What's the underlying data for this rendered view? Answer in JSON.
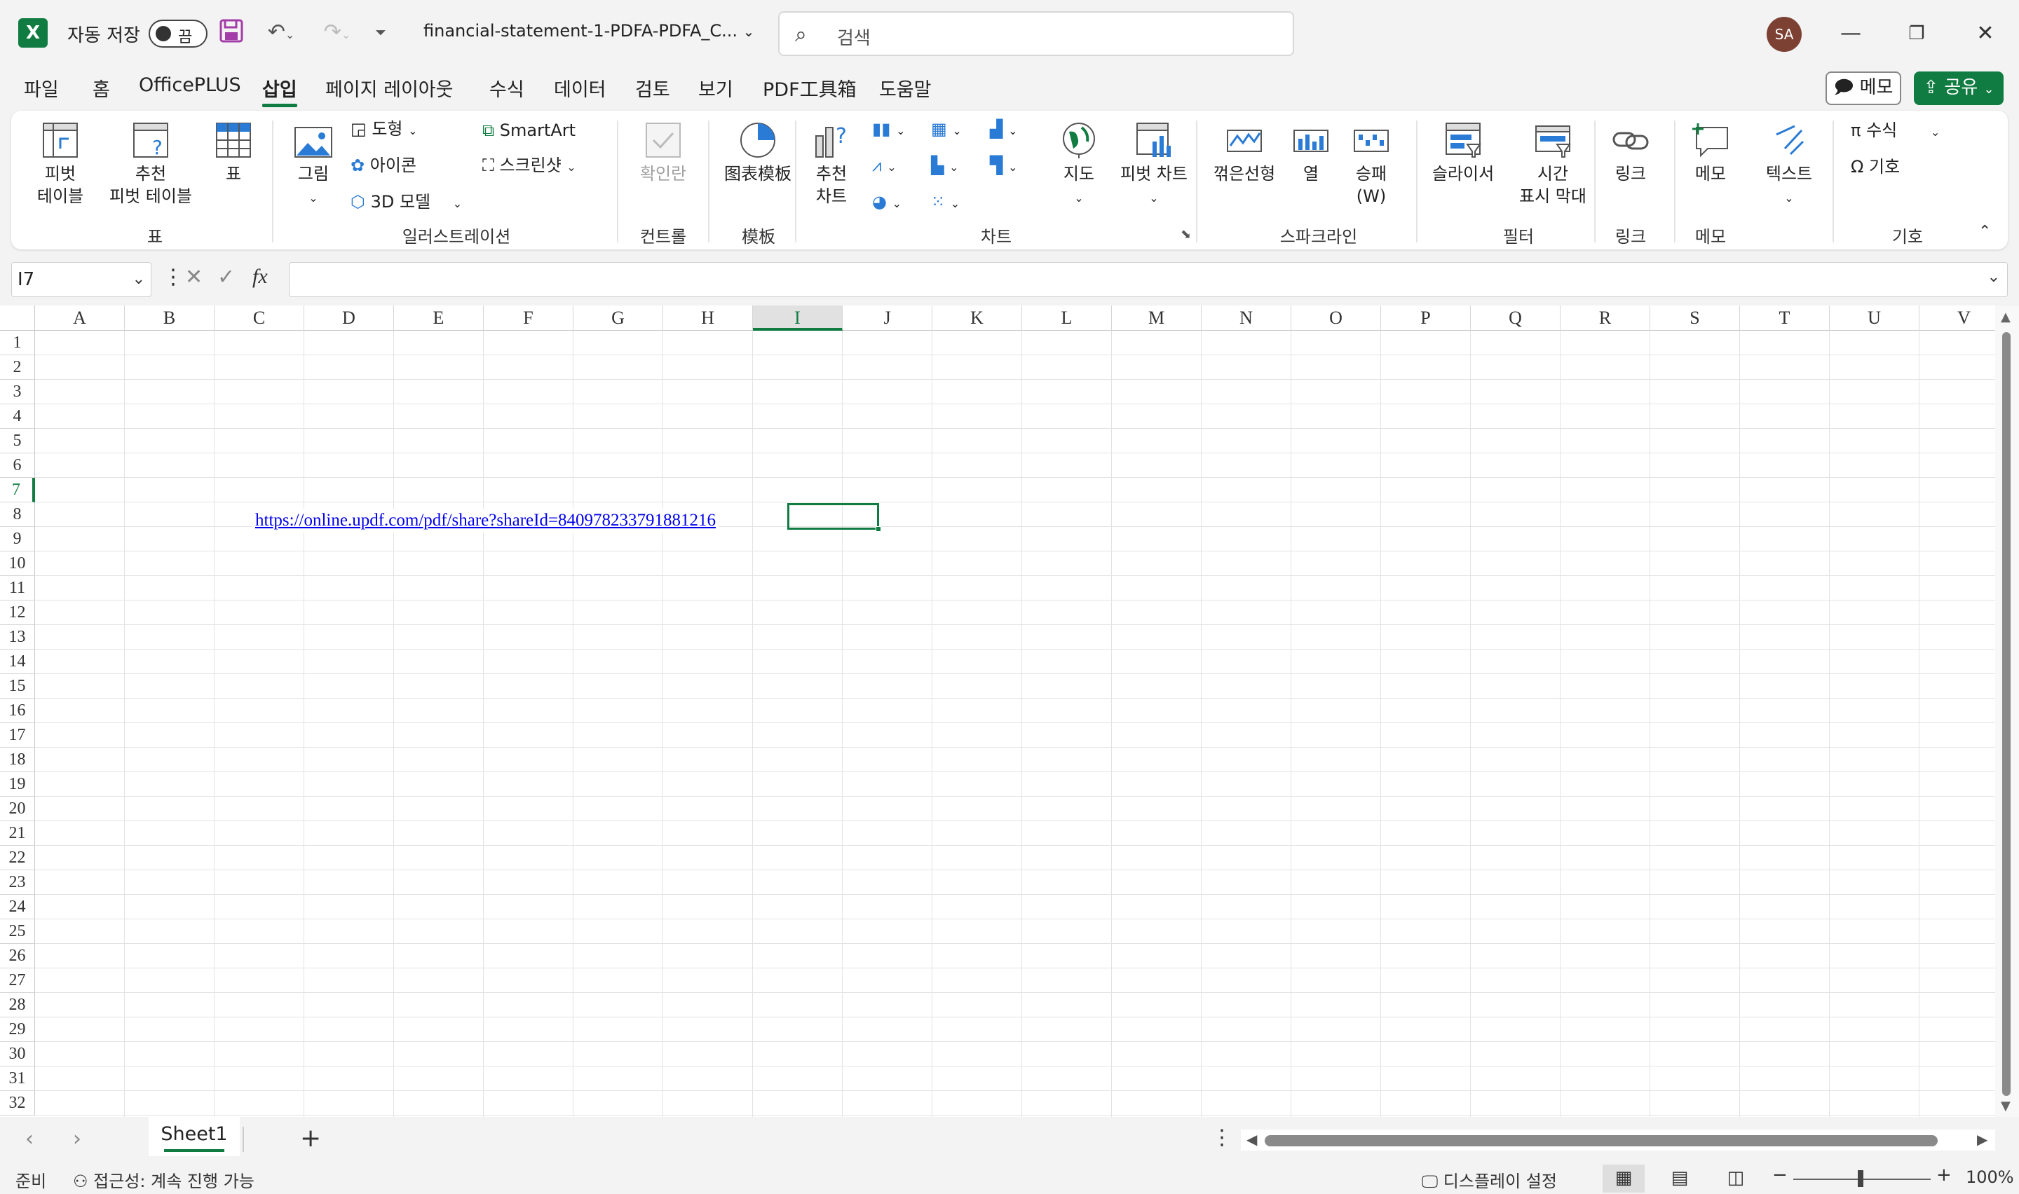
{
  "titlebar": {
    "app_logo": "X",
    "autosave_label": "자동 저장",
    "autosave_state": "끔",
    "doc_title": "financial-statement-1-PDFA-PDFA_C...",
    "search_placeholder": "검색",
    "avatar_initials": "SA"
  },
  "tabs": [
    "파일",
    "홈",
    "OfficePLUS",
    "삽입",
    "페이지 레이아웃",
    "수식",
    "데이터",
    "검토",
    "보기",
    "PDF工具箱",
    "도움말"
  ],
  "active_tab": "삽입",
  "memo_button": "메모",
  "share_button": "공유",
  "ribbon": {
    "pivot_table": "피벗\n테이블",
    "recommended_pivot": "추천\n피벗 테이블",
    "table": "표",
    "group_table": "표",
    "picture": "그림",
    "shapes": "도형",
    "icons": "아이콘",
    "models3d": "3D 모델",
    "smartart": "SmartArt",
    "screenshot": "스크린샷",
    "group_illustration": "일러스트레이션",
    "checkbox": "확인란",
    "group_controls": "컨트롤",
    "template": "图表模板",
    "group_template": "模板",
    "recommended_charts": "추천\n차트",
    "maps": "지도",
    "pivot_chart": "피벗 차트",
    "group_charts": "차트",
    "sparkline_line": "꺾은선형",
    "sparkline_column": "열",
    "sparkline_winloss": "승패\n(W)",
    "group_sparklines": "스파크라인",
    "slicer": "슬라이서",
    "timeline": "시간\n표시 막대",
    "group_filters": "필터",
    "link": "링크",
    "group_links": "링크",
    "comment": "메모",
    "group_comments": "메모",
    "text": "텍스트",
    "equation": "수식",
    "symbol": "기호",
    "group_symbols": "기호"
  },
  "formula_bar": {
    "name_box": "I7",
    "fx": "fx",
    "value": ""
  },
  "grid": {
    "columns": [
      "A",
      "B",
      "C",
      "D",
      "E",
      "F",
      "G",
      "H",
      "I",
      "J",
      "K",
      "L",
      "M",
      "N",
      "O",
      "P",
      "Q",
      "R",
      "S",
      "T",
      "U",
      "V"
    ],
    "selected_column": "I",
    "rows": [
      "1",
      "2",
      "3",
      "4",
      "5",
      "6",
      "7",
      "8",
      "9",
      "10",
      "11",
      "12",
      "13",
      "14",
      "15",
      "16",
      "17",
      "18",
      "19",
      "20",
      "21",
      "22",
      "23",
      "24",
      "25",
      "26",
      "27",
      "28",
      "29",
      "30",
      "31",
      "32"
    ],
    "selected_row": "7",
    "cell_C7": "https://online.updf.com/pdf/share?shareId=840978233791881216"
  },
  "sheets": [
    "Sheet1"
  ],
  "status": {
    "ready": "준비",
    "accessibility": "접근성: 계속 진행 가능",
    "display_settings": "디스플레이 설정",
    "zoom": "100%"
  }
}
